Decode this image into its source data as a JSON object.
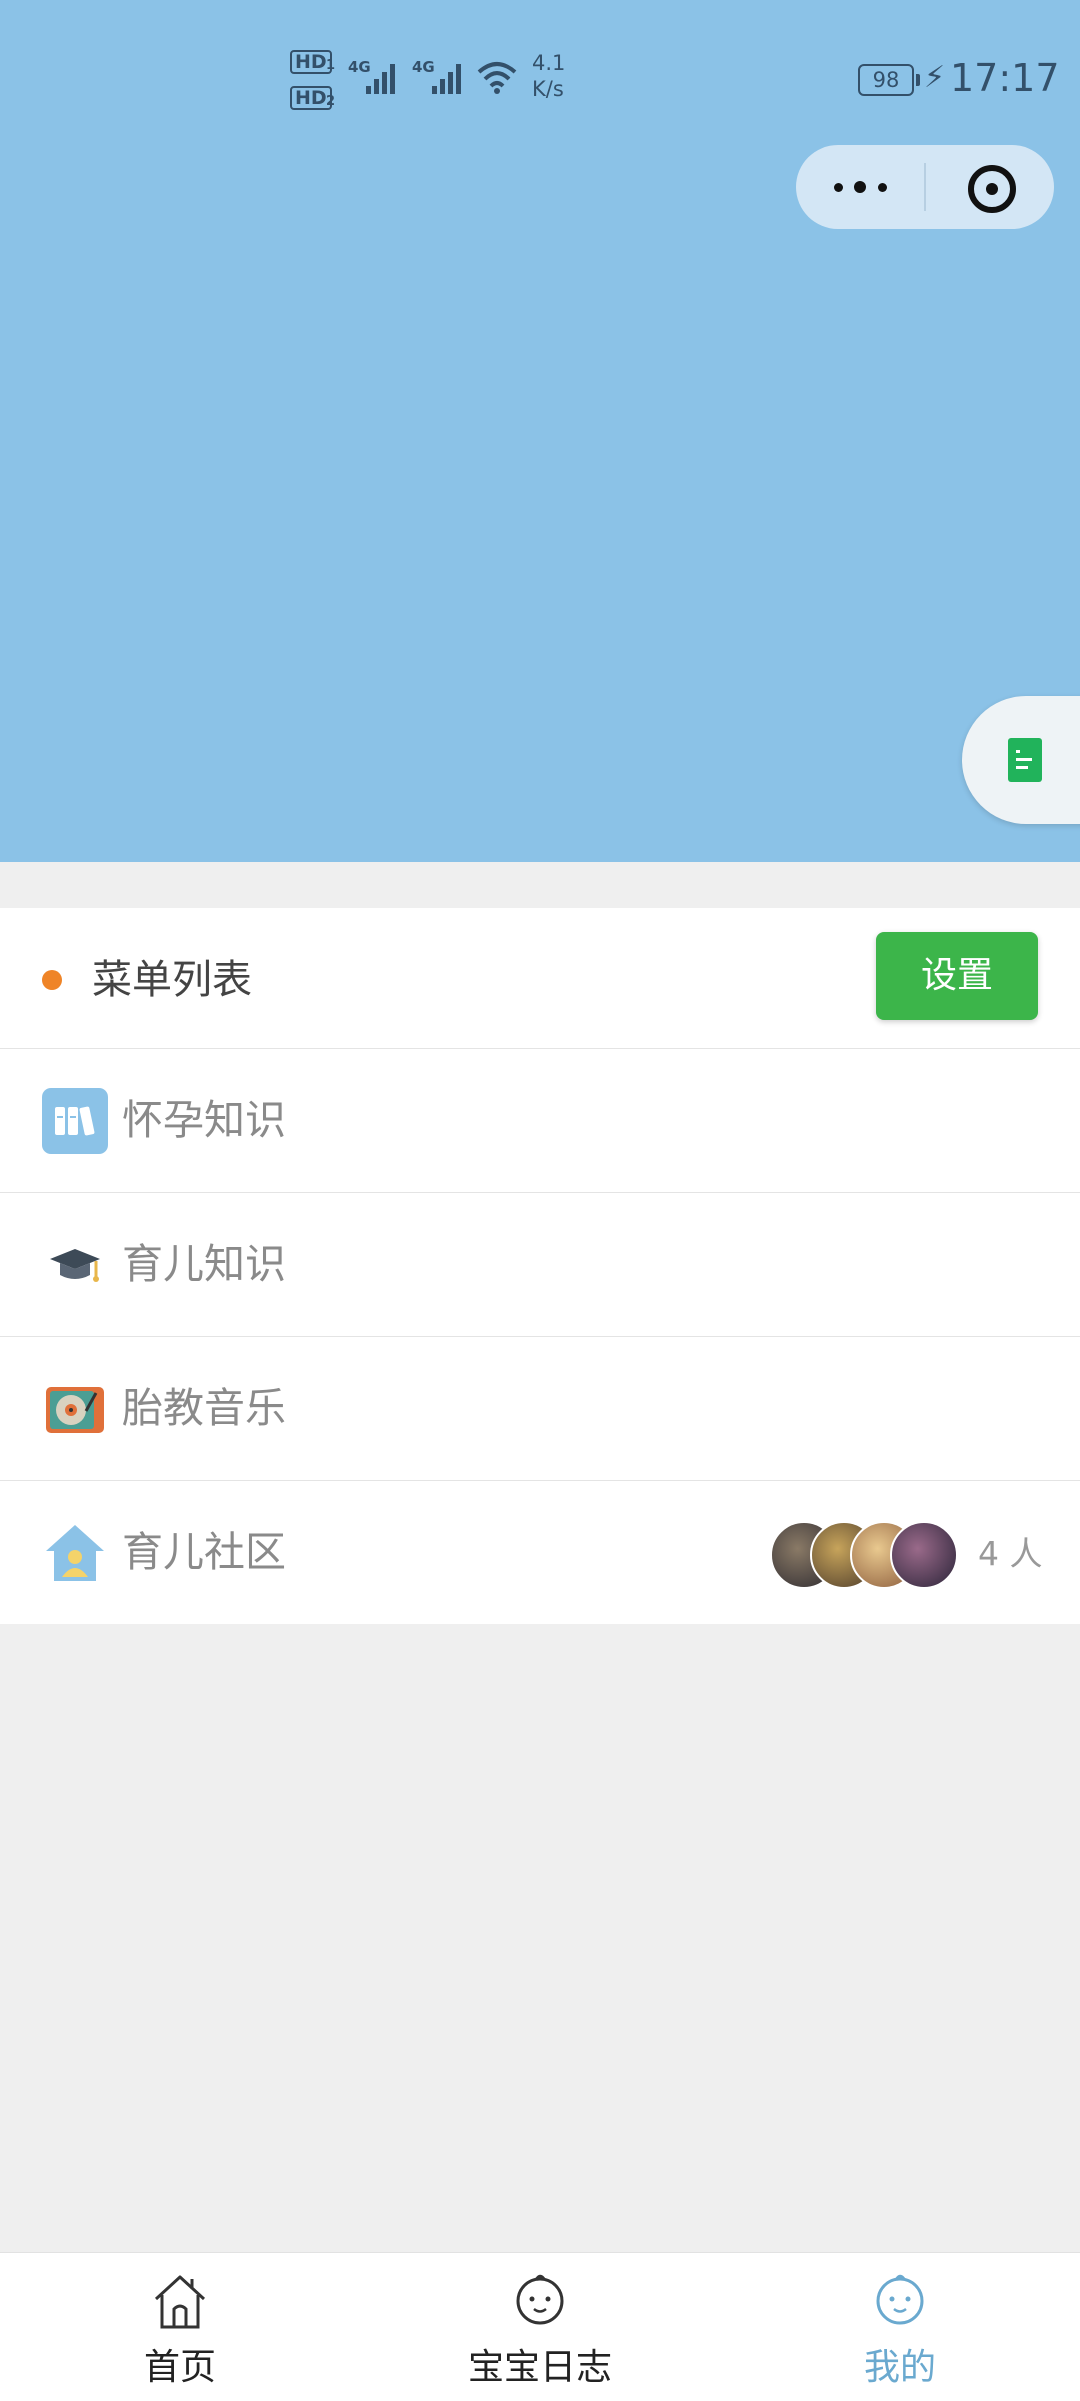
{
  "status_bar": {
    "hd1": "HD",
    "sim1": "1",
    "hd2": "HD",
    "sim2": "2",
    "net1": "4G",
    "net2": "4G",
    "speed_value": "4.1",
    "speed_unit": "K/s",
    "battery": "98",
    "time": "17:17"
  },
  "capsule": {
    "more_icon": "more-dots-icon",
    "close_icon": "target-close-icon"
  },
  "float_button": {
    "icon": "document-icon"
  },
  "menu": {
    "title": "菜单列表",
    "settings_label": "设置",
    "items": [
      {
        "label": "怀孕知识",
        "icon": "books-icon"
      },
      {
        "label": "育儿知识",
        "icon": "graduation-cap-icon"
      },
      {
        "label": "胎教音乐",
        "icon": "record-player-icon"
      },
      {
        "label": "育儿社区",
        "icon": "house-person-icon",
        "count": "4 人"
      }
    ]
  },
  "tabbar": {
    "tabs": [
      {
        "label": "首页",
        "icon": "home-icon",
        "active": false
      },
      {
        "label": "宝宝日志",
        "icon": "baby-face-icon",
        "active": false
      },
      {
        "label": "我的",
        "icon": "baby-face-icon",
        "active": true
      }
    ]
  },
  "colors": {
    "header_bg": "#8bc2e7",
    "accent_green": "#3cb54a",
    "dot_orange": "#ef8427",
    "tab_active": "#6aa9cf"
  }
}
